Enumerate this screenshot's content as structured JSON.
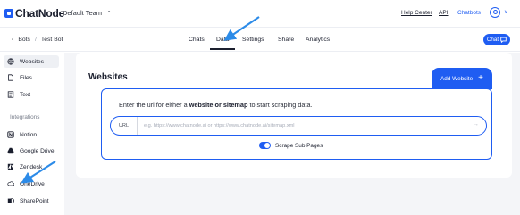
{
  "header": {
    "logo_text": "ChatNode",
    "team": "Default Team",
    "team_chevron": "⌃",
    "links": {
      "help": "Help Center",
      "api": "API",
      "chatbots": "Chatbots"
    },
    "avatar_chevron": "∨"
  },
  "subbar": {
    "back": "‹",
    "breadcrumb": [
      "Bots",
      "Test Bot"
    ],
    "separator": "/",
    "tabs": [
      {
        "label": "Chats",
        "active": false
      },
      {
        "label": "Data",
        "active": true
      },
      {
        "label": "Settings",
        "active": false
      },
      {
        "label": "Share",
        "active": false
      },
      {
        "label": "Analytics",
        "active": false
      }
    ],
    "chat_button": "Chat"
  },
  "sidebar": {
    "items": [
      {
        "label": "Websites",
        "icon": "globe-icon",
        "selected": true
      },
      {
        "label": "Files",
        "icon": "file-icon",
        "selected": false
      },
      {
        "label": "Text",
        "icon": "text-icon",
        "selected": false
      }
    ],
    "integrations_heading": "Integrations",
    "integrations": [
      {
        "label": "Notion",
        "icon": "notion-icon"
      },
      {
        "label": "Google Drive",
        "icon": "google-drive-icon"
      },
      {
        "label": "Zendesk",
        "icon": "zendesk-icon"
      },
      {
        "label": "OneDrive",
        "icon": "onedrive-icon"
      },
      {
        "label": "SharePoint",
        "icon": "sharepoint-icon"
      }
    ]
  },
  "main": {
    "title": "Websites",
    "add_button": "Add Website",
    "add_button_icon": "+",
    "instruction_prefix": "Enter the url for either a",
    "instruction_bold": "website or sitemap",
    "instruction_suffix": "to start scraping data.",
    "url_label": "URL",
    "url_value": "",
    "url_placeholder": "e.g. https://www.chatnode.ai or https://www.chatnode.ai/sitemap.xml",
    "url_go": "→",
    "toggle_label": "Scrape Sub Pages",
    "toggle_on": true
  },
  "colors": {
    "accent": "#1f5df2",
    "text": "#1b1f2e",
    "background": "#f4f5f8",
    "annotation": "#2c8be8"
  }
}
